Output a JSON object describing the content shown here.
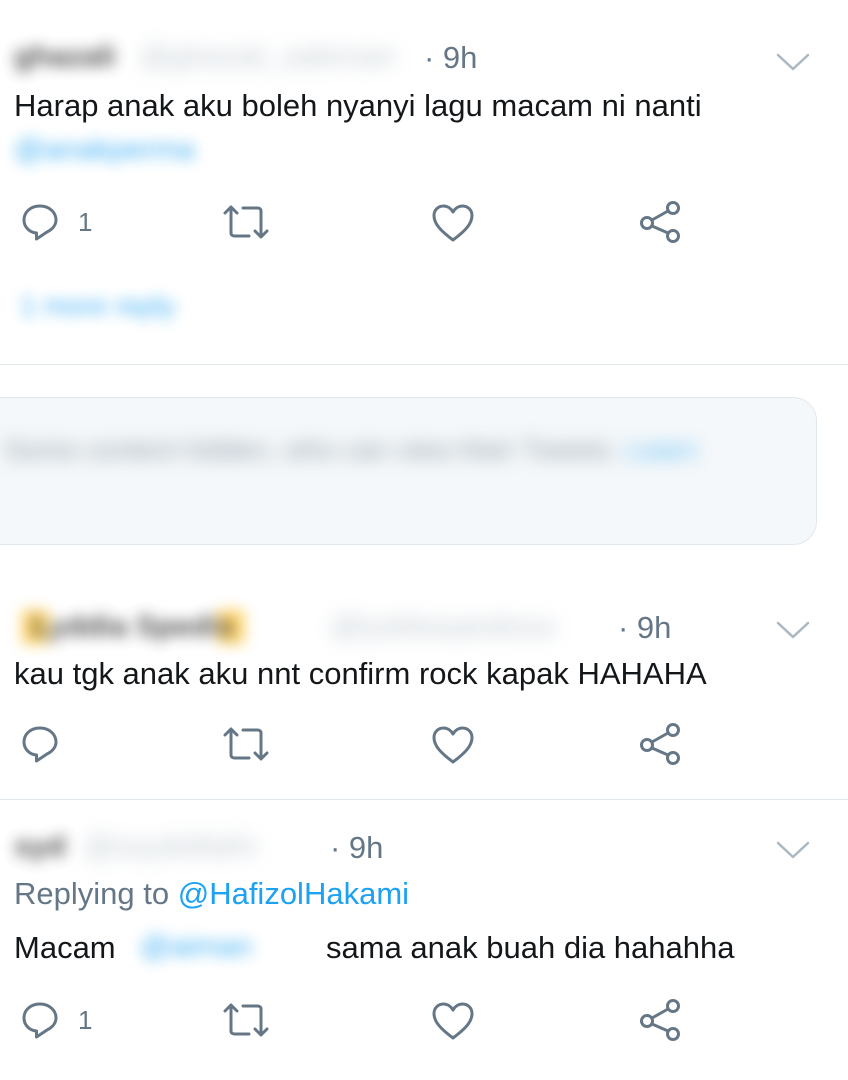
{
  "tweets": [
    {
      "name": "ghazali",
      "handle": "@ghazali_saleman",
      "time": "· 9h",
      "text": "Harap anak aku boleh nyanyi lagu macam ni nanti",
      "mention": "@anakperma",
      "reply_count": "1",
      "show_replies": "1 more reply"
    },
    {
      "name": "Lyddia Spedis",
      "handle": "@lyddiaspedisss",
      "time": "· 9h",
      "text": "kau tgk anak aku nnt confirm rock kapak HAHAHA"
    },
    {
      "name": "syd",
      "handle": "@ssydelfathi",
      "time": "· 9h",
      "replying_prefix": "Replying to ",
      "replying_to": "@HafizolHakami",
      "text_before": "Macam ",
      "mention": "@aiman",
      "text_after": "sama anak buah dia hahahha",
      "reply_count": "1"
    }
  ],
  "notice": {
    "text": "Some content hidden, who can view their Tweets.",
    "link": "Learn"
  },
  "colors": {
    "text": "#14171a",
    "secondary": "#657786",
    "accent": "#1da1f2",
    "divider": "#e1e8ed",
    "notice_bg": "#f5f8fa"
  },
  "icons": [
    "reply-icon",
    "retweet-icon",
    "like-icon",
    "share-icon",
    "chevron-down-icon"
  ]
}
